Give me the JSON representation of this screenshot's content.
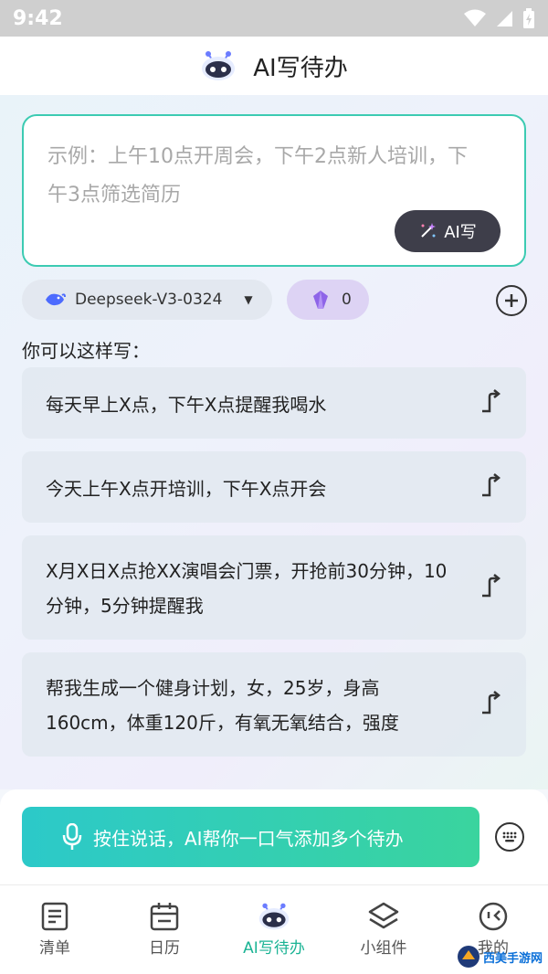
{
  "status_bar": {
    "time": "9:42"
  },
  "header": {
    "title": "AI写待办"
  },
  "input": {
    "placeholder": "示例：上午10点开周会，下午2点新人培训，下午3点筛选简历",
    "ai_button_label": "AI写"
  },
  "model": {
    "name": "Deepseek-V3-0324"
  },
  "credits": {
    "count": "0"
  },
  "hint": {
    "label": "你可以这样写："
  },
  "suggestions": [
    {
      "text": "每天早上X点，下午X点提醒我喝水"
    },
    {
      "text": "今天上午X点开培训，下午X点开会"
    },
    {
      "text": "X月X日X点抢XX演唱会门票，开抢前30分钟，10分钟，5分钟提醒我"
    },
    {
      "text": "帮我生成一个健身计划，女，25岁，身高160cm，体重120斤，有氧无氧结合，强度"
    }
  ],
  "voice": {
    "label": "按住说话，AI帮你一口气添加多个待办"
  },
  "tabs": [
    {
      "label": "清单",
      "icon": "list-icon"
    },
    {
      "label": "日历",
      "icon": "calendar-icon"
    },
    {
      "label": "AI写待办",
      "icon": "robot-icon",
      "active": true
    },
    {
      "label": "小组件",
      "icon": "layers-icon"
    },
    {
      "label": "我的",
      "icon": "profile-icon"
    }
  ],
  "watermark": {
    "text": "西美手游网"
  },
  "colors": {
    "accent": "#1ab394",
    "border": "#3ccbb2",
    "voice_gradient_start": "#2cc9c9",
    "voice_gradient_end": "#3ad49e",
    "credit_pill": "#ddd3f4"
  }
}
